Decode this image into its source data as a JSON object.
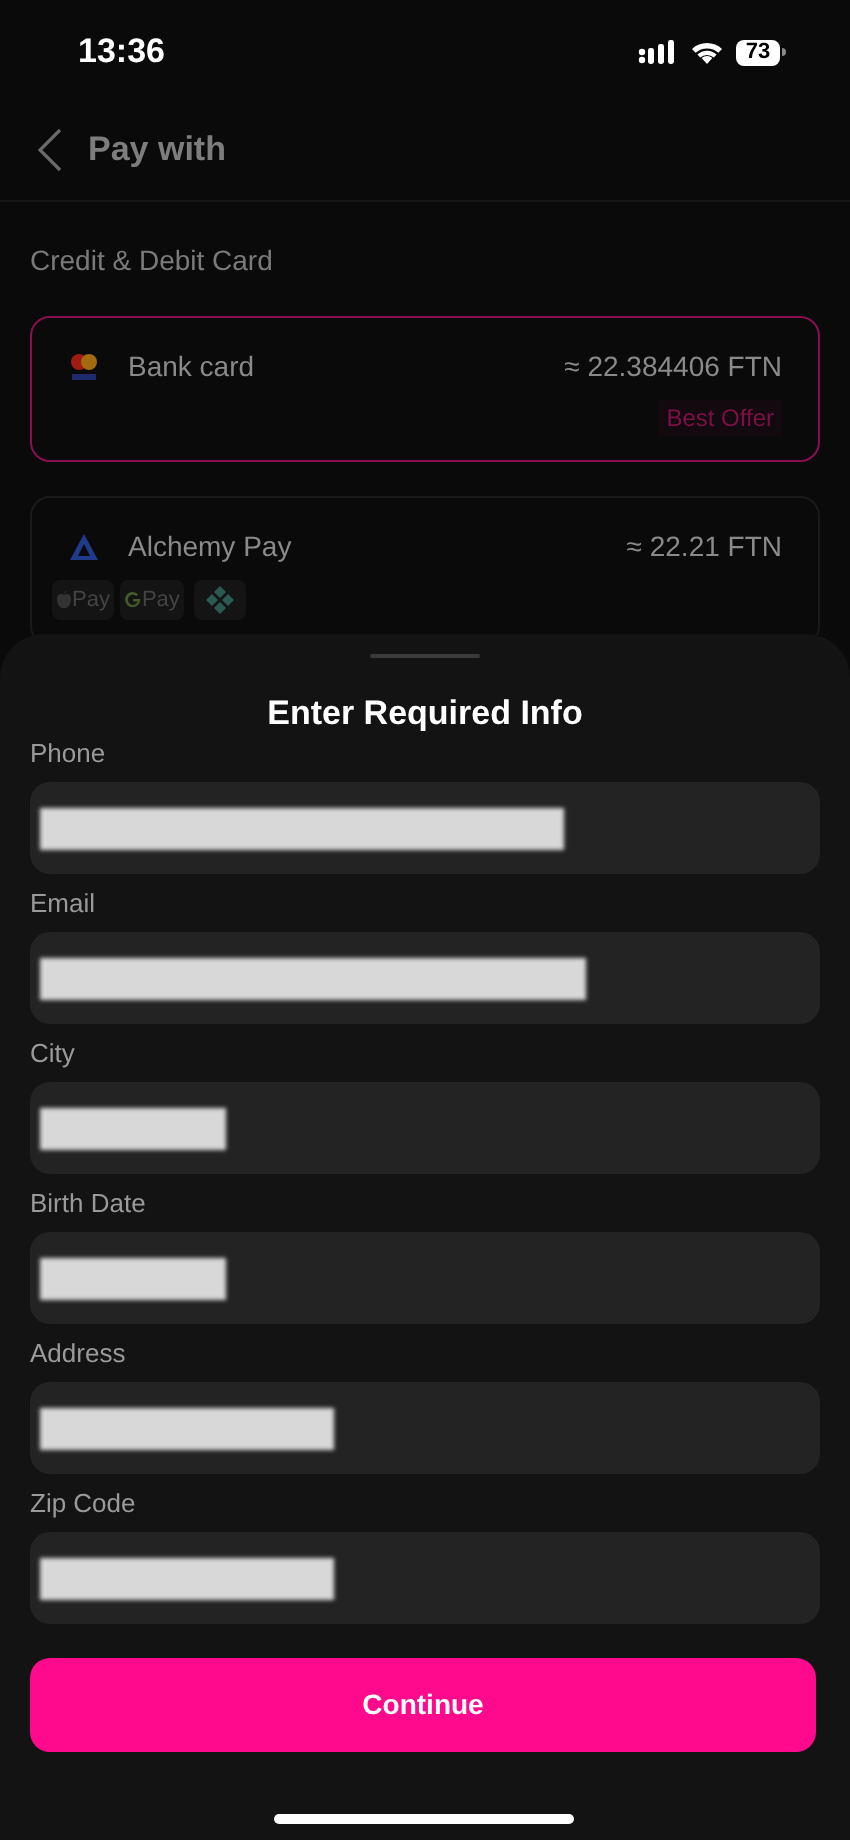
{
  "status_bar": {
    "time": "13:36",
    "battery": "73"
  },
  "header": {
    "title": "Pay with"
  },
  "section_title": "Credit & Debit Card",
  "methods": [
    {
      "kind": "card",
      "name": "Bank card",
      "amount": "≈ 22.384406 FTN",
      "badge": "Best Offer",
      "selected": true
    },
    {
      "kind": "alchemy",
      "name": "Alchemy Pay",
      "amount": "≈ 22.21 FTN",
      "selected": false,
      "options": [
        {
          "kind": "apple",
          "text": "Pay"
        },
        {
          "kind": "google",
          "text": "Pay"
        },
        {
          "kind": "diamond"
        }
      ]
    }
  ],
  "sheet": {
    "title": "Enter Required Info",
    "fields": [
      {
        "label": "Phone"
      },
      {
        "label": "Email"
      },
      {
        "label": "City"
      },
      {
        "label": "Birth Date"
      },
      {
        "label": "Address"
      },
      {
        "label": "Zip Code"
      }
    ],
    "button": "Continue"
  }
}
